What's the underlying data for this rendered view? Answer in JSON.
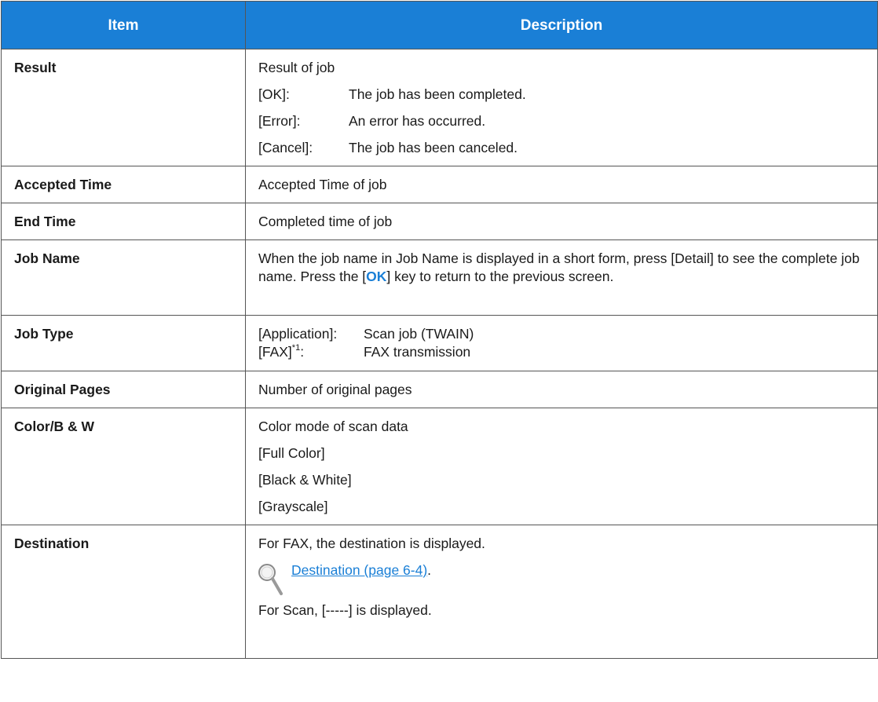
{
  "header": {
    "item": "Item",
    "description": "Description"
  },
  "rows": {
    "result": {
      "item": "Result",
      "intro": "Result of job",
      "options": [
        {
          "key": "[OK]:",
          "text": "The job has been completed."
        },
        {
          "key": "[Error]:",
          "text": "An error has occurred."
        },
        {
          "key": "[Cancel]:",
          "text": "The job has been canceled."
        }
      ]
    },
    "accepted": {
      "item": "Accepted Time",
      "text": "Accepted Time of job"
    },
    "end": {
      "item": "End Time",
      "text": "Completed time of job"
    },
    "jobname": {
      "item": "Job Name",
      "text_before": "When the job name in Job Name is displayed in a short form, press [Detail] to see the complete job name. Press the [",
      "key": "OK",
      "text_after": "] key to return to the previous screen."
    },
    "jobtype": {
      "item": "Job Type",
      "app_key": "[Application]:",
      "app_text": "Scan job (TWAIN)",
      "fax_key": "[FAX]",
      "fax_sup": "*1",
      "fax_colon": ":",
      "fax_text": "FAX transmission"
    },
    "pages": {
      "item": "Original Pages",
      "text": "Number of original pages"
    },
    "color": {
      "item": "Color/B & W",
      "intro": "Color mode of scan data",
      "options": [
        "[Full Color]",
        "[Black & White]",
        "[Grayscale]"
      ]
    },
    "destination": {
      "item": "Destination",
      "text1": "For FAX, the destination is displayed.",
      "link": "Destination (page 6-4)",
      "link_suffix": ".",
      "text2": "For Scan, [-----] is displayed.",
      "icon": "magnifier-icon"
    }
  },
  "colors": {
    "header_bg": "#1a7fd6",
    "header_text": "#ffffff",
    "link": "#1a7fd6",
    "border": "#555555"
  }
}
